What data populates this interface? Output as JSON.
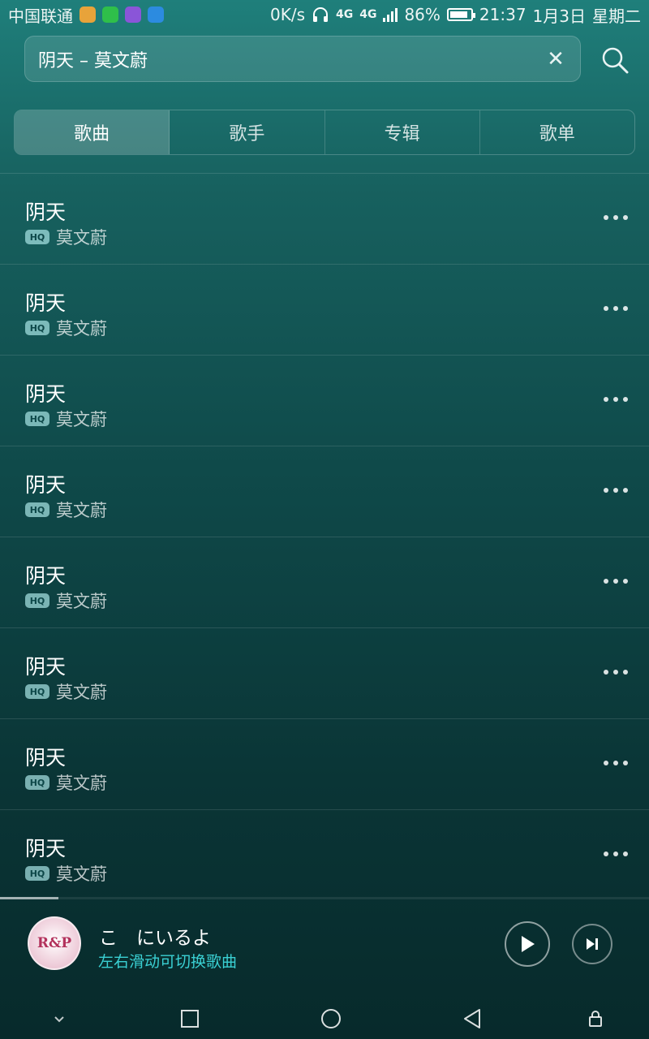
{
  "status_bar": {
    "carrier": "中国联通",
    "net_speed": "0K/s",
    "network": "4G",
    "network2": "4G",
    "battery": "86%",
    "battery_level": 0.86,
    "time": "21:37",
    "date": "1月3日",
    "weekday": "星期二",
    "notification_icons": [
      "app-icon-orange",
      "wechat-icon",
      "gallery-icon",
      "message-icon"
    ]
  },
  "search": {
    "query": "阴天 – 莫文蔚",
    "clear_icon": "close-icon",
    "search_icon": "search-icon"
  },
  "tabs": [
    {
      "label": "歌曲",
      "active": true
    },
    {
      "label": "歌手",
      "active": false
    },
    {
      "label": "专辑",
      "active": false
    },
    {
      "label": "歌单",
      "active": false
    }
  ],
  "songs": [
    {
      "title": "阴天",
      "quality": "HQ",
      "artist": "莫文蔚"
    },
    {
      "title": "阴天",
      "quality": "HQ",
      "artist": "莫文蔚"
    },
    {
      "title": "阴天",
      "quality": "HQ",
      "artist": "莫文蔚"
    },
    {
      "title": "阴天",
      "quality": "HQ",
      "artist": "莫文蔚"
    },
    {
      "title": "阴天",
      "quality": "HQ",
      "artist": "莫文蔚"
    },
    {
      "title": "阴天",
      "quality": "HQ",
      "artist": "莫文蔚"
    },
    {
      "title": "阴天",
      "quality": "HQ",
      "artist": "莫文蔚"
    },
    {
      "title": "阴天",
      "quality": "HQ",
      "artist": "莫文蔚"
    }
  ],
  "now_playing": {
    "title": "こ　にいるよ",
    "hint": "左右滑动可切换歌曲",
    "album_art_text": "R&P",
    "progress": 0.09
  },
  "colors": {
    "accent": "#3ad0d3",
    "bg_top": "#1f7f7b",
    "bg_bottom": "#072a2b"
  }
}
